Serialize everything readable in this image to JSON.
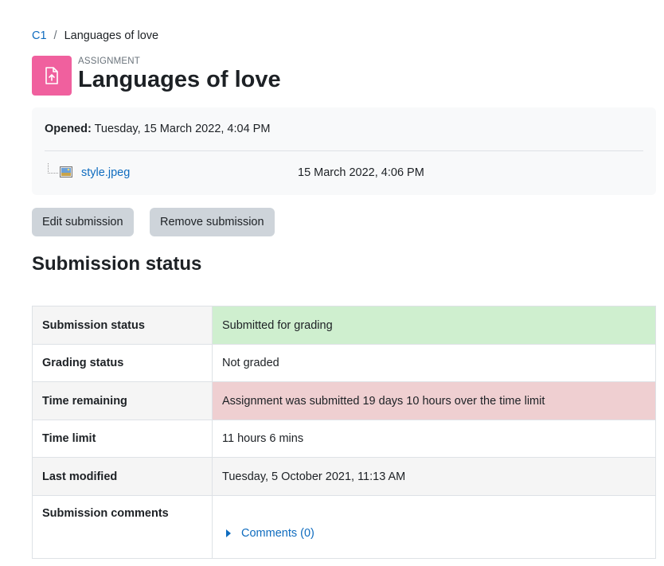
{
  "breadcrumb": {
    "course": "C1",
    "separator": "/",
    "current": "Languages of love"
  },
  "header": {
    "pretitle": "ASSIGNMENT",
    "title": "Languages of love",
    "icon": "assignment-upload-icon",
    "icon_color": "#f0609e"
  },
  "dates": {
    "opened_label": "Opened:",
    "opened_value": "Tuesday, 15 March 2022, 4:04 PM"
  },
  "file": {
    "name": "style.jpeg",
    "time": "15 March 2022, 4:06 PM",
    "icon": "image-file-icon"
  },
  "buttons": {
    "edit": "Edit submission",
    "remove": "Remove submission"
  },
  "section_title": "Submission status",
  "status_table": {
    "rows": [
      {
        "label": "Submission status",
        "value": "Submitted for grading",
        "color": "#cfefcf"
      },
      {
        "label": "Grading status",
        "value": "Not graded"
      },
      {
        "label": "Time remaining",
        "value": "Assignment was submitted 19 days 10 hours over the time limit",
        "color": "#efcfd1"
      },
      {
        "label": "Time limit",
        "value": "11 hours 6 mins"
      },
      {
        "label": "Last modified",
        "value": "Tuesday, 5 October 2021, 11:13 AM"
      },
      {
        "label": "Submission comments",
        "value": "Comments (0)"
      }
    ]
  },
  "colors": {
    "link": "#0f6cbf",
    "button_bg": "#ced4da"
  }
}
